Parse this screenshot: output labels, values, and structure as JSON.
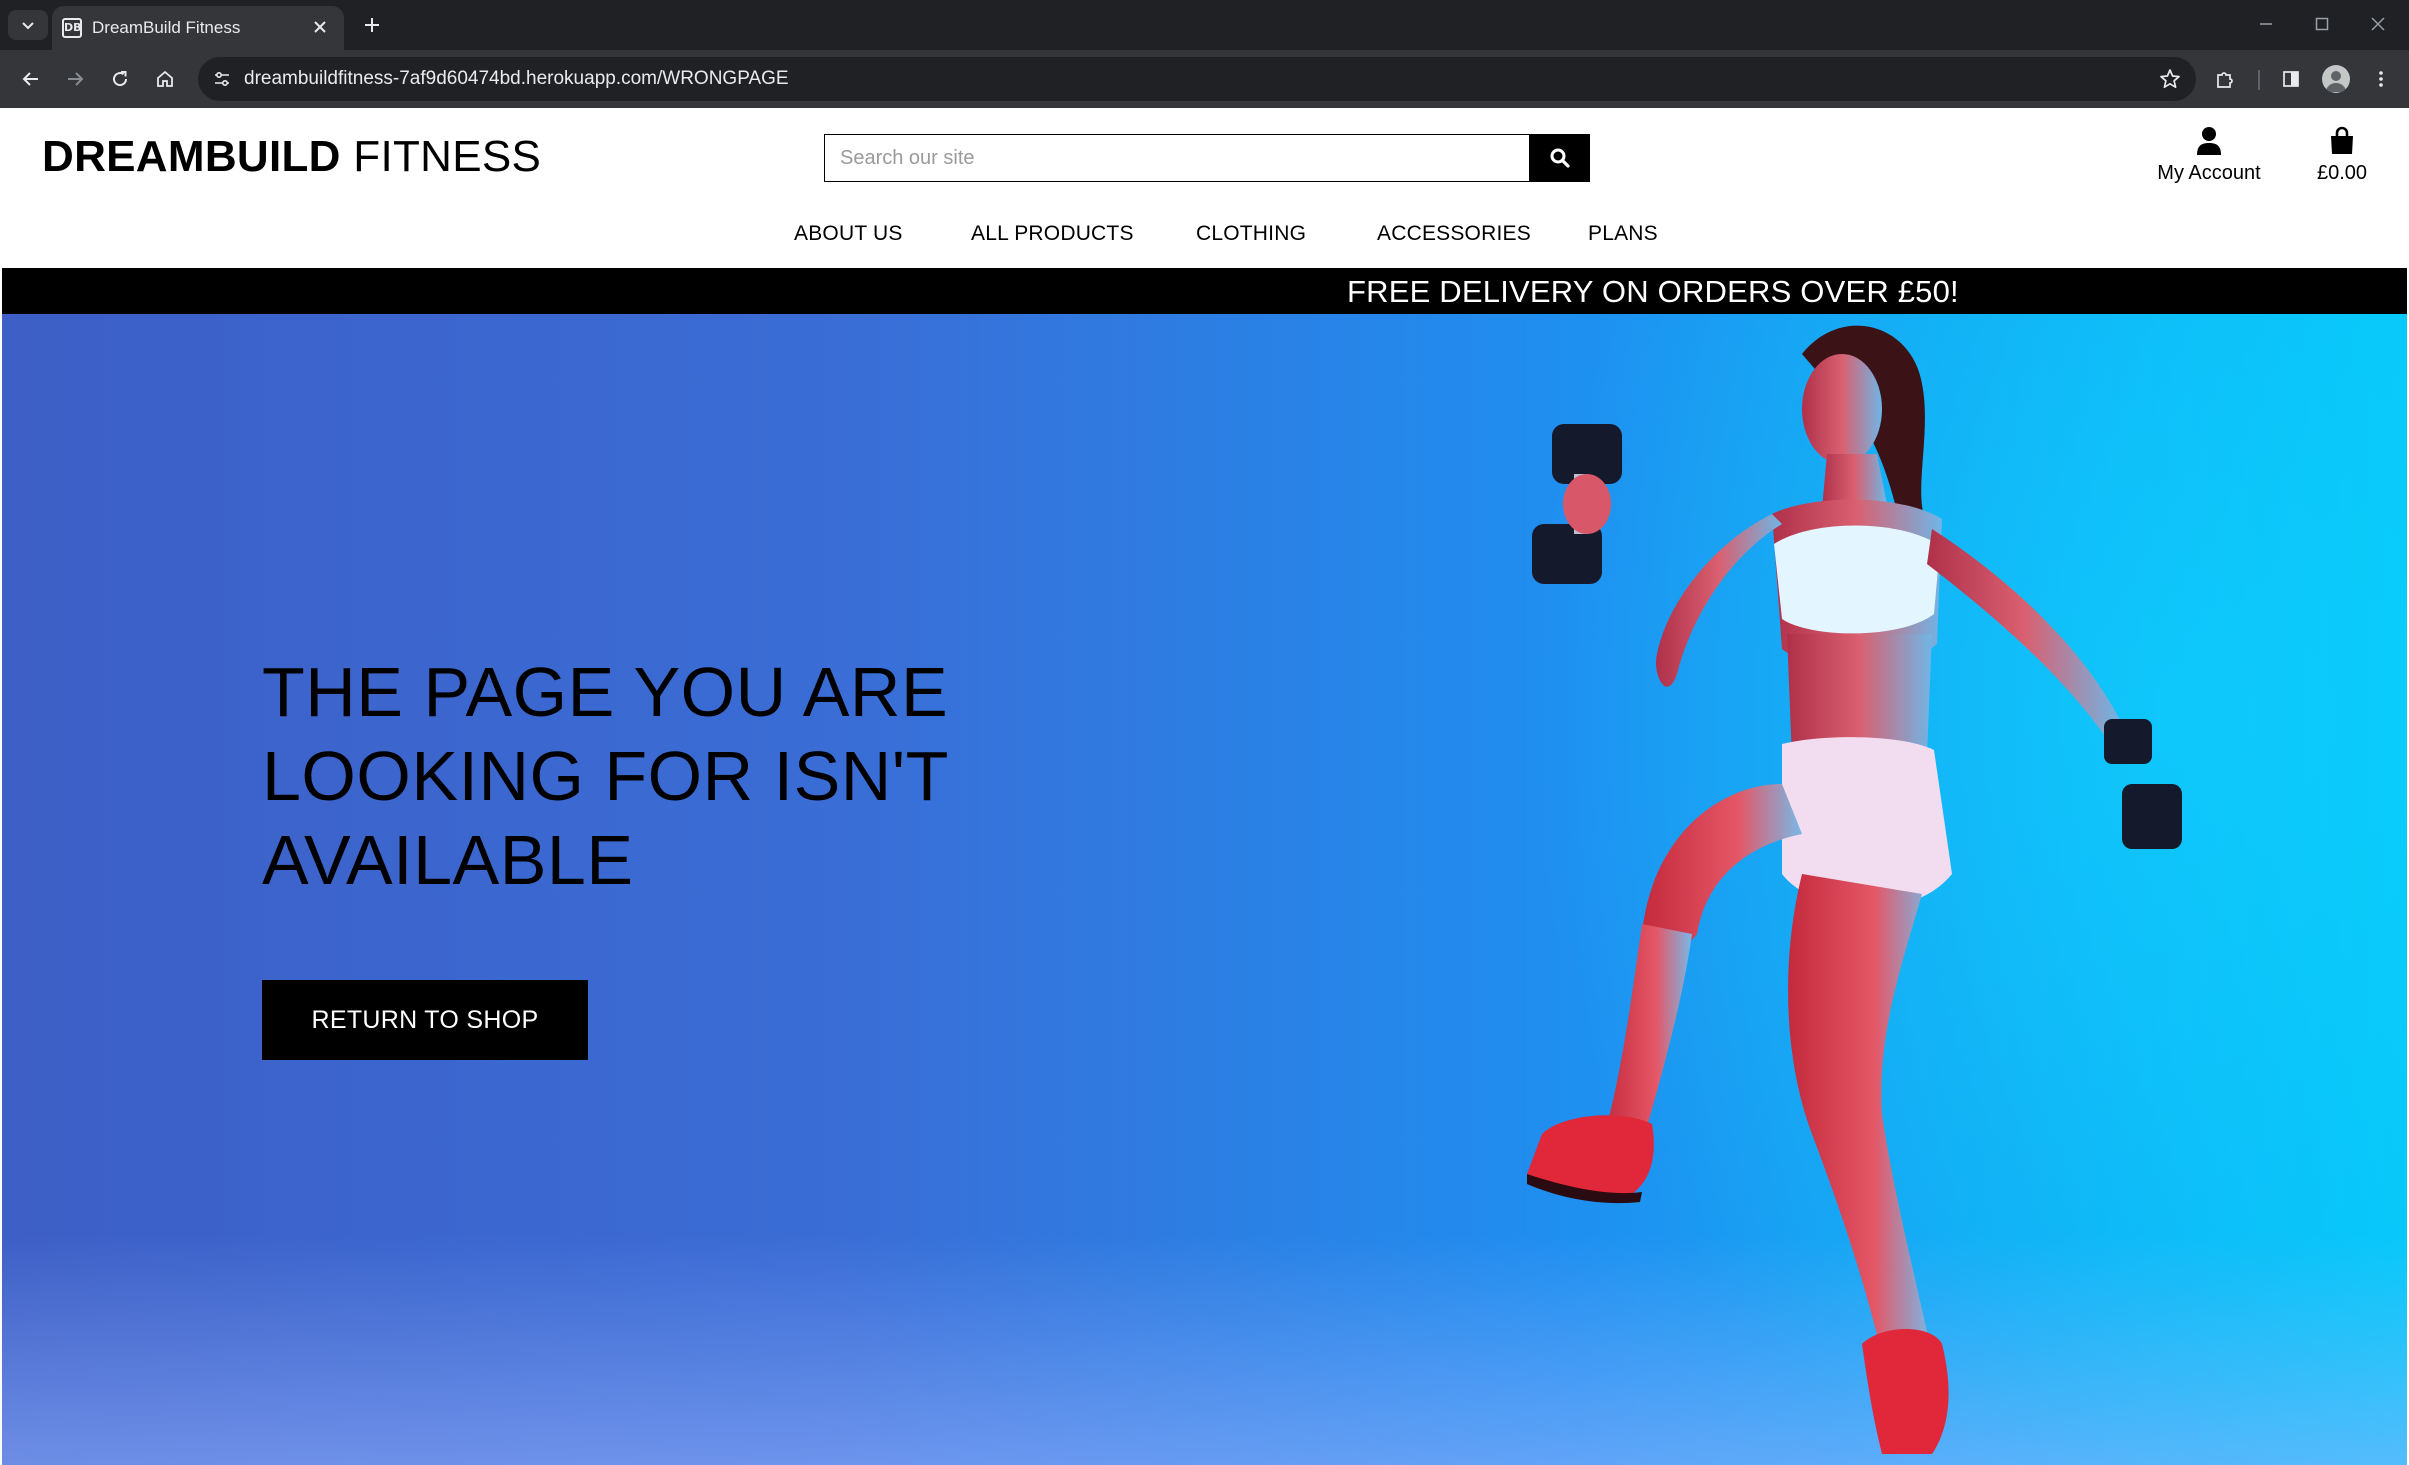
{
  "browser": {
    "tab_title": "DreamBuild Fitness",
    "favicon_text": "DB",
    "url": "dreambuildfitness-7af9d60474bd.herokuapp.com/WRONGPAGE"
  },
  "header": {
    "brand_bold": "DREAMBUILD",
    "brand_light": "FITNESS",
    "search_placeholder": "Search our site",
    "account_label": "My Account",
    "cart_total": "£0.00"
  },
  "nav": {
    "items": [
      {
        "label": "ABOUT US"
      },
      {
        "label": "ALL PRODUCTS"
      },
      {
        "label": "CLOTHING"
      },
      {
        "label": "ACCESSORIES"
      },
      {
        "label": "PLANS"
      }
    ]
  },
  "promo_banner": "FREE DELIVERY ON ORDERS OVER £50!",
  "hero": {
    "title": "THE PAGE YOU ARE LOOKING FOR ISN'T AVAILABLE",
    "button_label": "RETURN TO SHOP"
  },
  "colors": {
    "chrome_dark": "#202124",
    "chrome_toolbar": "#35363a",
    "banner": "#000000",
    "hero_left": "#3d5fc6",
    "hero_right": "#06c6f9",
    "sneaker_red": "#e0283a"
  },
  "icons": {
    "tab_menu": "chevron-down-icon",
    "tab_close": "close-icon",
    "new_tab": "plus-icon",
    "back": "back-arrow-icon",
    "forward": "forward-arrow-icon",
    "reload": "reload-icon",
    "home": "home-icon",
    "site_info": "tune-icon",
    "bookmark": "star-icon",
    "extensions": "puzzle-icon",
    "side_panel": "side-panel-icon",
    "profile": "avatar-icon",
    "menu": "kebab-menu-icon",
    "search": "search-icon",
    "account": "user-icon",
    "cart": "shopping-bag-icon"
  }
}
